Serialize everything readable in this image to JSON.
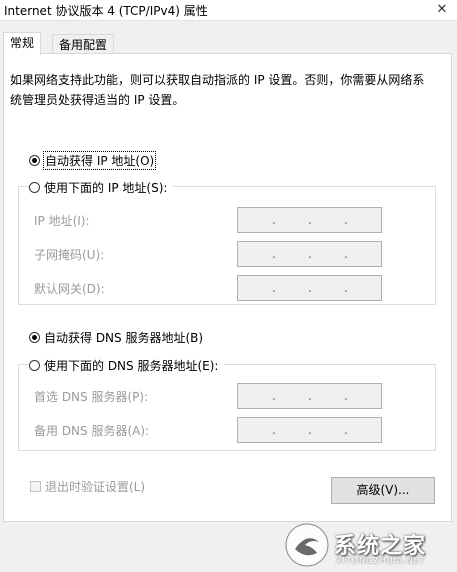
{
  "window": {
    "title": "Internet 协议版本 4 (TCP/IPv4) 属性"
  },
  "tabs": [
    {
      "label": "常规",
      "active": true
    },
    {
      "label": "备用配置",
      "active": false
    }
  ],
  "description": "如果网络支持此功能，则可以获取自动指派的 IP 设置。否则，你需要从网络系统管理员处获得适当的 IP 设置。",
  "ip": {
    "auto_label": "自动获得 IP 地址(O)",
    "manual_label": "使用下面的 IP 地址(S):",
    "auto_selected": true,
    "fields": [
      {
        "label": "IP 地址(I):",
        "value": ". . ."
      },
      {
        "label": "子网掩码(U):",
        "value": ". . ."
      },
      {
        "label": "默认网关(D):",
        "value": ". . ."
      }
    ]
  },
  "dns": {
    "auto_label": "自动获得 DNS 服务器地址(B)",
    "manual_label": "使用下面的 DNS 服务器地址(E):",
    "auto_selected": true,
    "fields": [
      {
        "label": "首选 DNS 服务器(P):",
        "value": ". . ."
      },
      {
        "label": "备用 DNS 服务器(A):",
        "value": ". . ."
      }
    ]
  },
  "validate_label": "退出时验证设置(L)",
  "advanced_label": "高级(V)...",
  "watermark": {
    "text": "系统之家",
    "sub": "XITONGZHIJIA.NET"
  }
}
